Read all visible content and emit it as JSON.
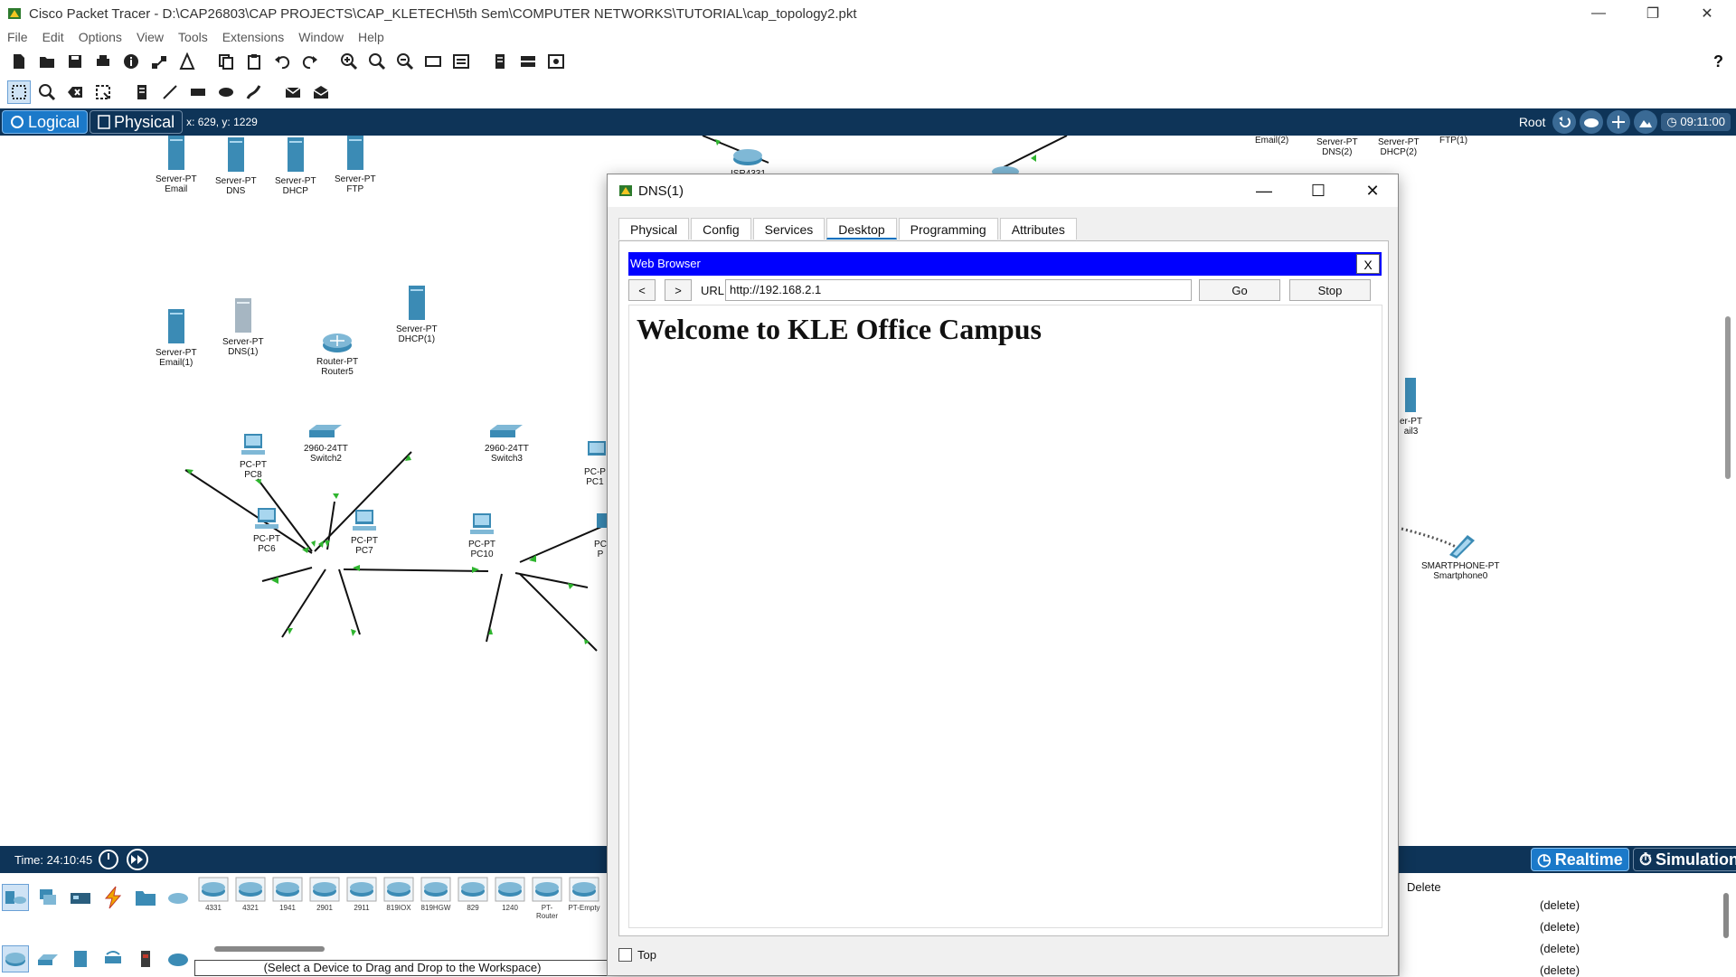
{
  "app": {
    "title": "Cisco Packet Tracer - D:\\CAP26803\\CAP PROJECTS\\CAP_KLETECH\\5th Sem\\COMPUTER NETWORKS\\TUTORIAL\\cap_topology2.pkt"
  },
  "menu": [
    "File",
    "Edit",
    "Options",
    "View",
    "Tools",
    "Extensions",
    "Window",
    "Help"
  ],
  "toolbar": {
    "help_label": "?"
  },
  "modebar": {
    "logical": "Logical",
    "physical": "Physical",
    "coords": "x: 629, y: 1229",
    "root": "Root",
    "clock": "09:11:00"
  },
  "workspace": {
    "devices": [
      {
        "type": "Server-PT",
        "name": "Email"
      },
      {
        "type": "Server-PT",
        "name": "DNS"
      },
      {
        "type": "Server-PT",
        "name": "DHCP"
      },
      {
        "type": "Server-PT",
        "name": "FTP"
      },
      {
        "type": "Server-PT",
        "name": "Email(1)"
      },
      {
        "type": "Server-PT",
        "name": "DNS(1)"
      },
      {
        "type": "Router-PT",
        "name": "Router5"
      },
      {
        "type": "Server-PT",
        "name": "DHCP(1)"
      },
      {
        "type": "2960-24TT",
        "name": "Switch2"
      },
      {
        "type": "2960-24TT",
        "name": "Switch3"
      },
      {
        "type": "PC-PT",
        "name": "PC8"
      },
      {
        "type": "PC-PT",
        "name": "PC6"
      },
      {
        "type": "PC-PT",
        "name": "PC7"
      },
      {
        "type": "PC-PT",
        "name": "PC10"
      },
      {
        "type": "PC-P",
        "name": "PC1"
      },
      {
        "type": "PC",
        "name": "P"
      },
      {
        "type": "ISR4331",
        "name": ""
      },
      {
        "type": "Server-PT",
        "name": "Email(2)"
      },
      {
        "type": "Server-PT",
        "name": "DNS(2)"
      },
      {
        "type": "Server-PT",
        "name": "DHCP(2)"
      },
      {
        "type": "Server-PT",
        "name": "FTP(1)"
      },
      {
        "type": "er-PT",
        "name": "ail3"
      },
      {
        "type": "SMARTPHONE-PT",
        "name": "Smartphone0"
      }
    ]
  },
  "dialog": {
    "title": "DNS(1)",
    "tabs": [
      "Physical",
      "Config",
      "Services",
      "Desktop",
      "Programming",
      "Attributes"
    ],
    "active_tab": "Desktop",
    "browser": {
      "title": "Web Browser",
      "close": "X",
      "back": "<",
      "forward": ">",
      "url_label": "URL",
      "url": "http://192.168.2.1",
      "go": "Go",
      "stop": "Stop",
      "page_heading": "Welcome to KLE Office Campus"
    },
    "top_checkbox": "Top"
  },
  "bottom": {
    "time": "Time: 24:10:45",
    "realtime": "Realtime",
    "simulation": "Simulation",
    "models": [
      "4331",
      "4321",
      "1941",
      "2901",
      "2911",
      "819IOX",
      "819HGW",
      "829",
      "1240",
      "PT-Router",
      "PT-Empty"
    ],
    "hint": "(Select a Device to Drag and Drop to the Workspace)",
    "pdu_header": "Delete",
    "pdu_rows": [
      "(delete)",
      "(delete)",
      "(delete)",
      "(delete)"
    ]
  },
  "colors": {
    "modebar_bg": "#0e3458",
    "browser_bar": "#0000ff",
    "link_green": "#2fb52f"
  }
}
